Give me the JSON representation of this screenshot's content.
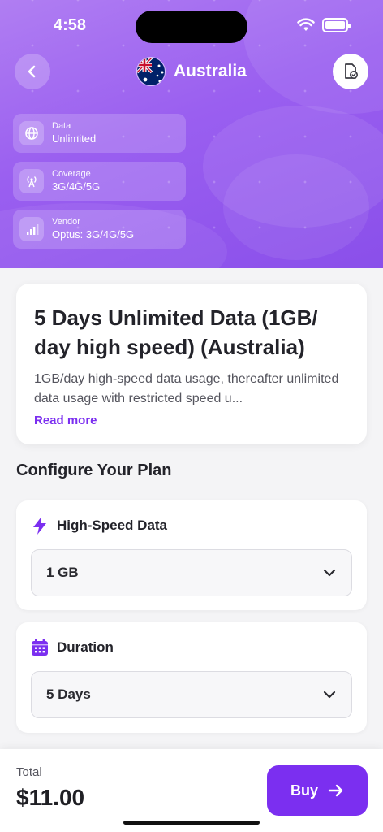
{
  "status_bar": {
    "time": "4:58"
  },
  "header": {
    "country": "Australia"
  },
  "info_cards": [
    {
      "label": "Data",
      "value": "Unlimited",
      "icon": "globe-icon"
    },
    {
      "label": "Coverage",
      "value": "3G/4G/5G",
      "icon": "antenna-icon"
    },
    {
      "label": "Vendor",
      "value": "Optus: 3G/4G/5G",
      "icon": "signal-bars-icon"
    }
  ],
  "plan": {
    "title": "5 Days Unlimited Data (1GB/ day high speed) (Australia)",
    "description": "1GB/day high-speed data usage, thereafter unlimited data usage with restricted speed u...",
    "read_more": "Read more"
  },
  "configure": {
    "title": "Configure Your Plan",
    "high_speed": {
      "label": "High-Speed Data",
      "selected": "1 GB"
    },
    "duration": {
      "label": "Duration",
      "selected": "5 Days"
    }
  },
  "footer": {
    "total_label": "Total",
    "total_value": "$11.00",
    "buy_label": "Buy"
  },
  "colors": {
    "accent": "#7b2ff0",
    "header_start": "#b07ef2",
    "header_end": "#8a4fea"
  }
}
